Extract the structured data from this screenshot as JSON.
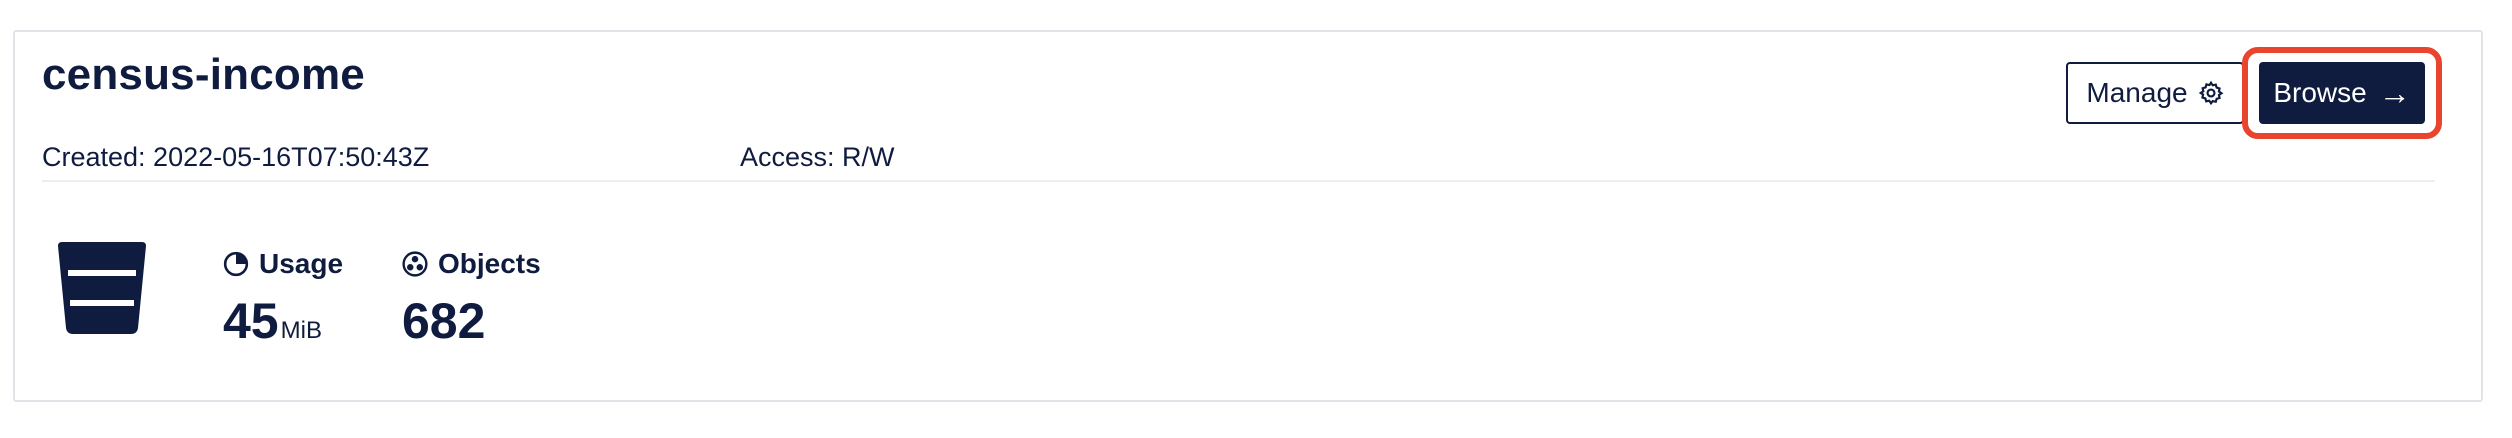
{
  "bucket": {
    "name": "census-income",
    "created_label": "Created: 2022-05-16T07:50:43Z",
    "access_label": "Access: R/W"
  },
  "actions": {
    "manage_label": "Manage",
    "browse_label": "Browse"
  },
  "stats": {
    "usage": {
      "label": "Usage",
      "value": "45",
      "unit": "MiB"
    },
    "objects": {
      "label": "Objects",
      "value": "682"
    }
  },
  "colors": {
    "primary": "#0f1c3f",
    "highlight": "#e8442e",
    "border": "#e1e3e8"
  },
  "icons": {
    "bucket": "bucket-icon",
    "manage": "gear-icon",
    "browse": "arrow-right-icon",
    "usage": "pie-chart-icon",
    "objects": "objects-icon"
  }
}
